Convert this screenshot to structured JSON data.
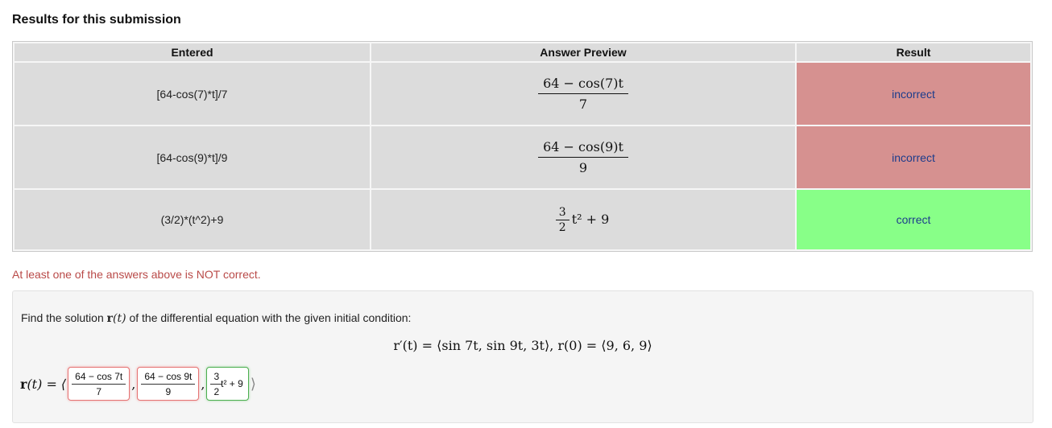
{
  "heading": "Results for this submission",
  "table": {
    "headers": {
      "entered": "Entered",
      "preview": "Answer Preview",
      "result": "Result"
    },
    "rows": [
      {
        "entered": "[64-cos(7)*t]/7",
        "preview_num": "64 − cos(7)t",
        "preview_den": "7",
        "result": "incorrect",
        "status_color": "#d69190"
      },
      {
        "entered": "[64-cos(9)*t]/9",
        "preview_num": "64 − cos(9)t",
        "preview_den": "9",
        "result": "incorrect",
        "status_color": "#d69190"
      },
      {
        "entered": "(3/2)*(t^2)+9",
        "preview_num": "3",
        "preview_den": "2",
        "preview_rest": "t² + 9",
        "result": "correct",
        "status_color": "#88ff88"
      }
    ]
  },
  "message": "At least one of the answers above is NOT correct.",
  "problem": {
    "prompt_before": "Find the solution",
    "prompt_var_r": "r",
    "prompt_var_t": "(t)",
    "prompt_after": "of the differential equation with the given initial condition:",
    "equation": "r′(t) = ⟨sin 7t, sin 9t, 3t⟩, r(0) = ⟨9, 6, 9⟩",
    "answer_label_r": "r",
    "answer_label_rest": "(t) = ⟨",
    "answer_close": "⟩",
    "separator": ",",
    "answers": [
      {
        "num": "64 − cos 7t",
        "den": "7"
      },
      {
        "num": "64 − cos 9t",
        "den": "9"
      },
      {
        "num": "3",
        "den": "2",
        "rest": "t² + 9"
      }
    ]
  },
  "colors": {
    "incorrect": "#d69190",
    "correct": "#88ff88",
    "link": "#1c3c8c",
    "message": "#b94a48"
  }
}
